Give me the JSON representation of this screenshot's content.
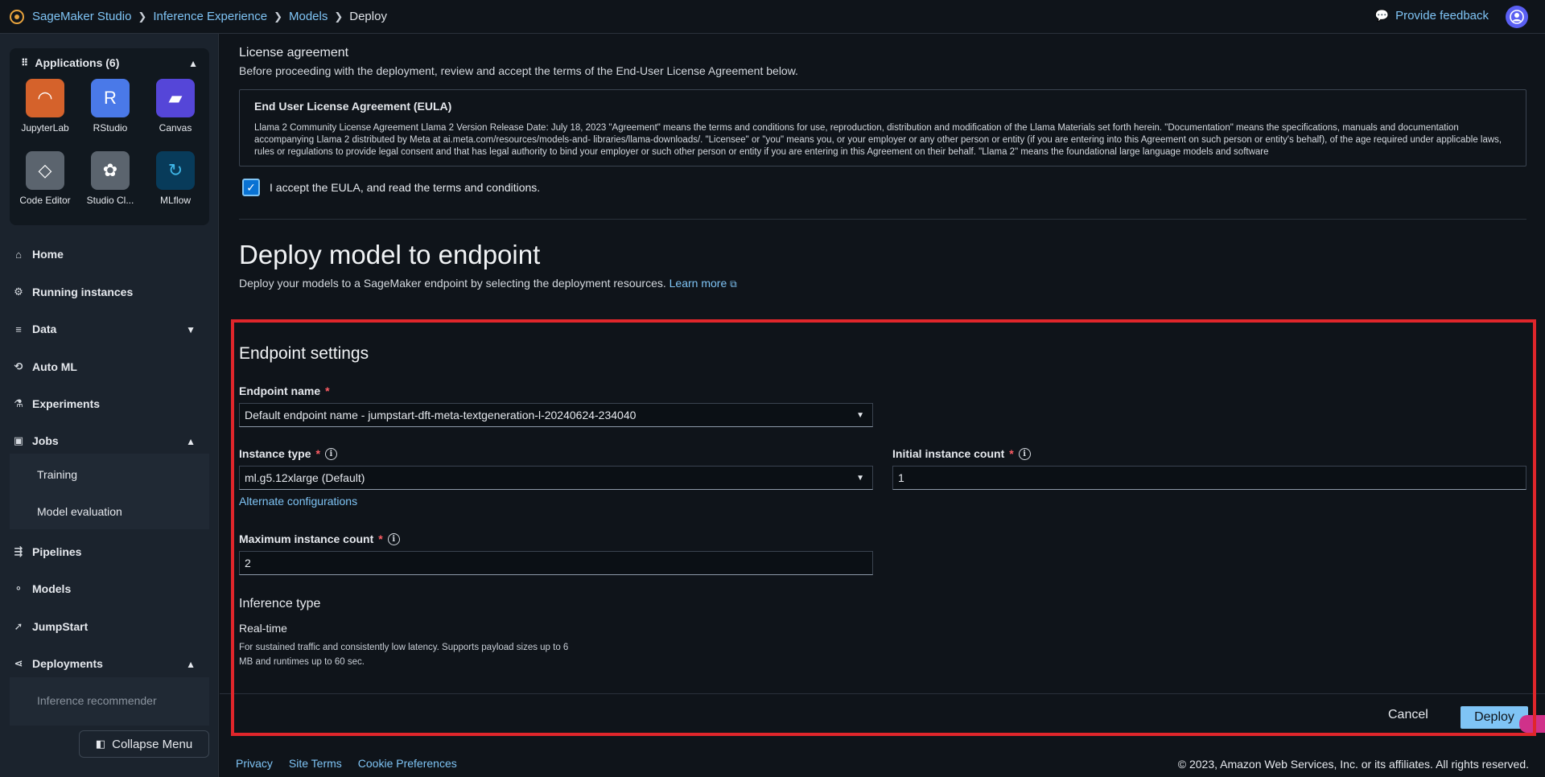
{
  "breadcrumb": {
    "items": [
      "SageMaker Studio",
      "Inference Experience",
      "Models",
      "Deploy"
    ]
  },
  "header": {
    "feedback": "Provide feedback",
    "avatar_icon": "user-icon"
  },
  "sidebar": {
    "apps_title": "Applications (6)",
    "apps": [
      {
        "label": "JupyterLab",
        "color": "#d5622b"
      },
      {
        "label": "RStudio",
        "color": "#4a79e8"
      },
      {
        "label": "Canvas",
        "color": "#5546d8"
      },
      {
        "label": "Code Editor",
        "color": "#5b646e"
      },
      {
        "label": "Studio Cl...",
        "color": "#5b646e"
      },
      {
        "label": "MLflow",
        "color": "#083b5a"
      }
    ],
    "nav": {
      "home": "Home",
      "running": "Running instances",
      "data": "Data",
      "automl": "Auto ML",
      "experiments": "Experiments",
      "jobs": "Jobs",
      "training": "Training",
      "model_eval": "Model evaluation",
      "pipelines": "Pipelines",
      "models": "Models",
      "jumpstart": "JumpStart",
      "deployments": "Deployments",
      "inference_rec": "Inference recommender"
    },
    "collapse": "Collapse Menu"
  },
  "license": {
    "title": "License agreement",
    "subtitle": "Before proceeding with the deployment, review and accept the terms of the End-User License Agreement below.",
    "eula_title": "End User License Agreement (EULA)",
    "eula_text": "Llama 2 Community License Agreement Llama 2 Version Release Date: July 18, 2023 \"Agreement\" means the terms and conditions for use, reproduction, distribution and modification of the Llama Materials set forth herein. \"Documentation\" means the specifications, manuals and documentation accompanying Llama 2 distributed by Meta at ai.meta.com/resources/models-and- libraries/llama-downloads/. \"Licensee\" or \"you\" means you, or your employer or any other person or entity (if you are entering into this Agreement on such person or entity's behalf), of the age required under applicable laws, rules or regulations to provide legal consent and that has legal authority to bind your employer or such other person or entity if you are entering in this Agreement on their behalf. \"Llama 2\" means the foundational large language models and software",
    "accept_label": "I accept the EULA, and read the terms and conditions."
  },
  "deploy": {
    "title": "Deploy model to endpoint",
    "subtitle": "Deploy your models to a SageMaker endpoint by selecting the deployment resources.",
    "learn_more": "Learn more"
  },
  "endpoint": {
    "title": "Endpoint settings",
    "name_label": "Endpoint name",
    "name_value": "Default endpoint name - jumpstart-dft-meta-textgeneration-l-20240624-234040",
    "instance_type_label": "Instance type",
    "instance_type_value": "ml.g5.12xlarge (Default)",
    "initial_count_label": "Initial instance count",
    "initial_count_value": "1",
    "alt_config": "Alternate configurations",
    "max_count_label": "Maximum instance count",
    "max_count_value": "2",
    "inference_type_title": "Inference type",
    "realtime_title": "Real-time",
    "realtime_desc": "For sustained traffic and consistently low latency. Supports payload sizes up to 6 MB and runtimes up to 60 sec.",
    "required_mark": "*"
  },
  "actions": {
    "cancel": "Cancel",
    "deploy": "Deploy"
  },
  "footer": {
    "privacy": "Privacy",
    "site_terms": "Site Terms",
    "cookie": "Cookie Preferences",
    "copyright": "© 2023, Amazon Web Services, Inc. or its affiliates. All rights reserved."
  }
}
